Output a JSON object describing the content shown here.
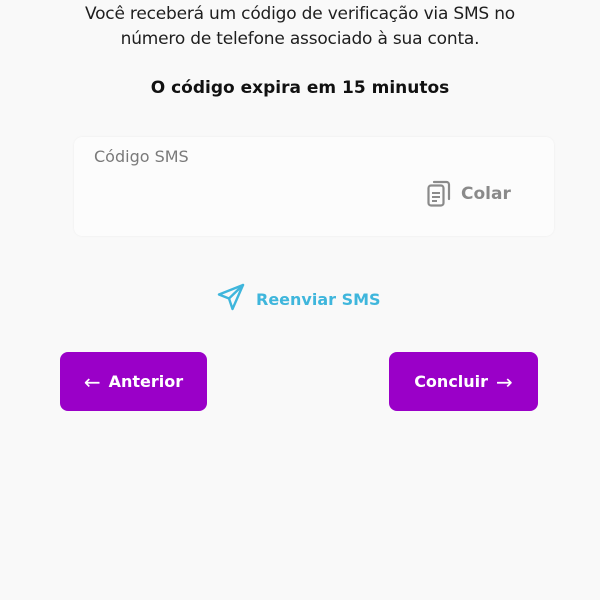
{
  "verification": {
    "description_line1": "Você receberá um código de verificação via SMS no",
    "description_line2": "número de telefone associado à sua conta.",
    "expiry_text": "O código expira em 15 minutos"
  },
  "sms_field": {
    "placeholder": "Código SMS",
    "value": "",
    "paste_label": "Colar",
    "paste_icon": "clipboard-icon"
  },
  "resend": {
    "label": "Reenviar SMS",
    "icon": "send-icon",
    "color": "#3fb6dc"
  },
  "navigation": {
    "previous_label": "Anterior",
    "previous_icon": "arrow-left-icon",
    "next_label": "Concluir",
    "next_icon": "arrow-right-icon",
    "button_color": "#9a00c8"
  }
}
